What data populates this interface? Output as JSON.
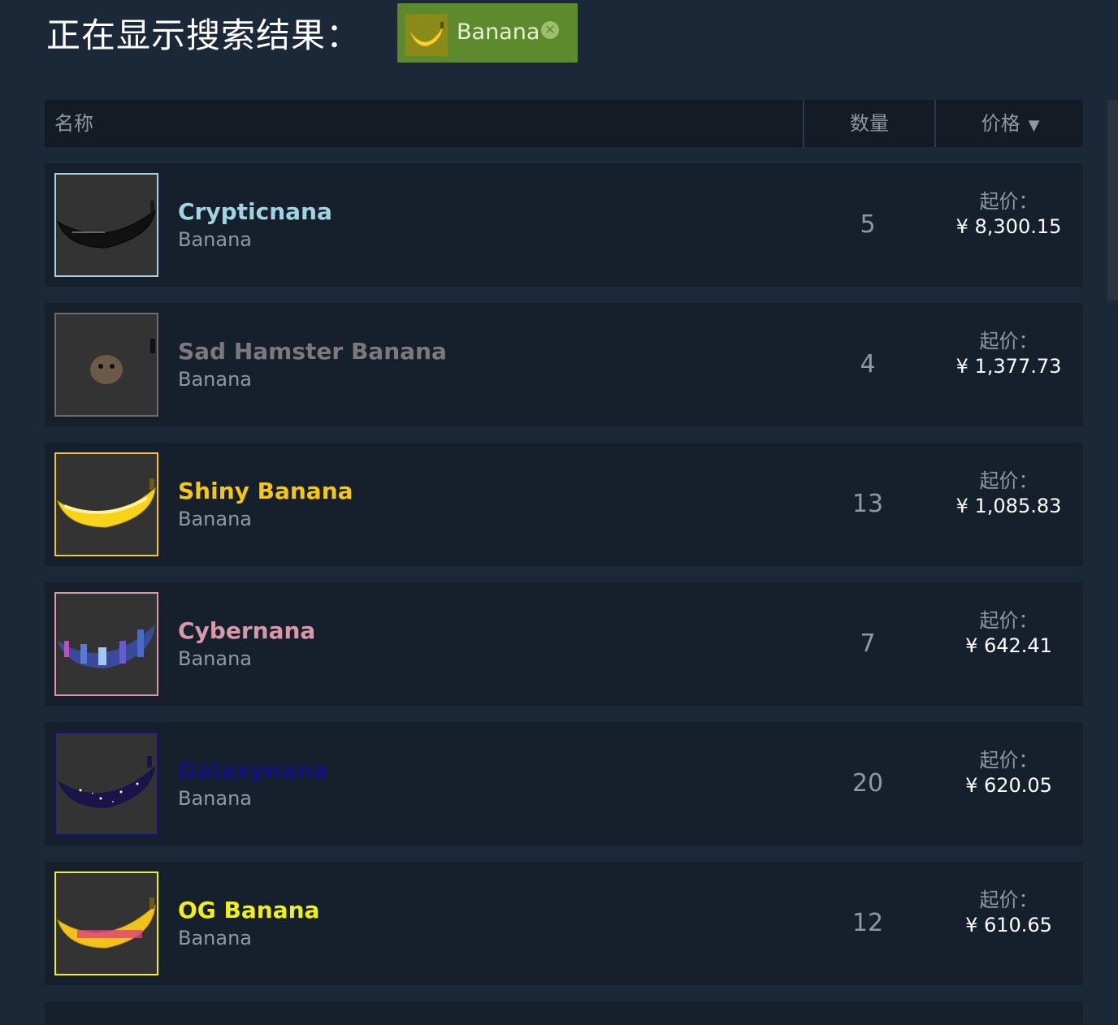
{
  "header": {
    "title": "正在显示搜索结果：",
    "filter_tag": {
      "label": "Banana",
      "close_glyph": "✕"
    }
  },
  "table": {
    "columns": {
      "name": "名称",
      "quantity": "数量",
      "price": "价格",
      "sort_indicator": "▼"
    }
  },
  "items": [
    {
      "name": "Crypticnana",
      "type": "Banana",
      "quantity": "5",
      "price_label": "起价：",
      "price": "¥ 8,300.15",
      "name_color": "#9fd4e0",
      "border_color": "#9fd4e0"
    },
    {
      "name": "Sad Hamster Banana",
      "type": "Banana",
      "quantity": "4",
      "price_label": "起价：",
      "price": "¥ 1,377.73",
      "name_color": "#7a7a7a",
      "border_color": "#6a6a6a"
    },
    {
      "name": "Shiny Banana",
      "type": "Banana",
      "quantity": "13",
      "price_label": "起价：",
      "price": "¥ 1,085.83",
      "name_color": "#f5c518",
      "border_color": "#f5c518"
    },
    {
      "name": "Cybernana",
      "type": "Banana",
      "quantity": "7",
      "price_label": "起价：",
      "price": "¥ 642.41",
      "name_color": "#d898a8",
      "border_color": "#d898a8"
    },
    {
      "name": "Galaxynana",
      "type": "Banana",
      "quantity": "20",
      "price_label": "起价：",
      "price": "¥ 620.05",
      "name_color": "#141080",
      "border_color": "#141080"
    },
    {
      "name": "OG Banana",
      "type": "Banana",
      "quantity": "12",
      "price_label": "起价：",
      "price": "¥ 610.65",
      "name_color": "#f0f018",
      "border_color": "#f0f018"
    }
  ]
}
